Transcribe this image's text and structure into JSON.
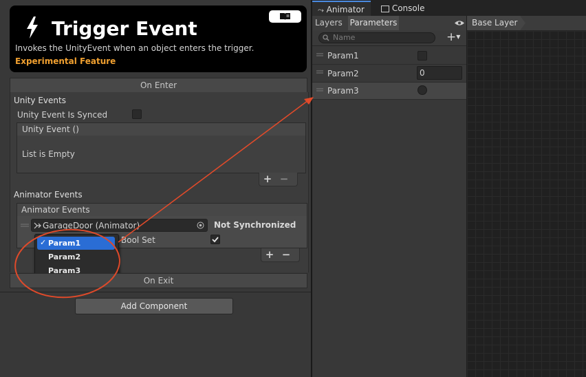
{
  "header": {
    "title": "Trigger Event",
    "description": "Invokes the UnityEvent when an object enters the trigger.",
    "experimental": "Experimental Feature"
  },
  "on_enter": {
    "bar_label": "On Enter",
    "unity_events_heading": "Unity Events",
    "synced_label": "Unity Event Is Synced",
    "synced_checked": false,
    "event_title": "Unity Event ()",
    "list_empty": "List is Empty"
  },
  "animator_events": {
    "heading": "Animator Events",
    "list_title": "Animator Events",
    "object_field": "GarageDoor (Animator)",
    "sync_status": "Not Synchronized",
    "bool_set_label": "Bool Set",
    "bool_set_checked": true,
    "dropdown_options": [
      "Param1",
      "Param2",
      "Param3"
    ],
    "dropdown_selected": "Param1"
  },
  "on_exit": {
    "bar_label": "On Exit"
  },
  "add_component": "Add Component",
  "animator_window": {
    "tabs": [
      "Animator",
      "Console"
    ],
    "subtabs": [
      "Layers",
      "Parameters"
    ],
    "search_placeholder": "Name",
    "breadcrumb": "Base Layer",
    "params": [
      {
        "name": "Param1",
        "type": "bool",
        "value": ""
      },
      {
        "name": "Param2",
        "type": "int",
        "value": "0"
      },
      {
        "name": "Param3",
        "type": "trigger",
        "value": ""
      }
    ]
  },
  "colors": {
    "accent": "#f0a030",
    "highlight": "#2a6dd5",
    "annotation": "#e04a2a"
  },
  "icons": [
    "lightning-icon",
    "book-icon",
    "plus-icon",
    "minus-icon",
    "search-icon",
    "eye-icon",
    "target-icon",
    "check-icon",
    "drag-handle-icon",
    "animator-icon",
    "console-icon"
  ]
}
